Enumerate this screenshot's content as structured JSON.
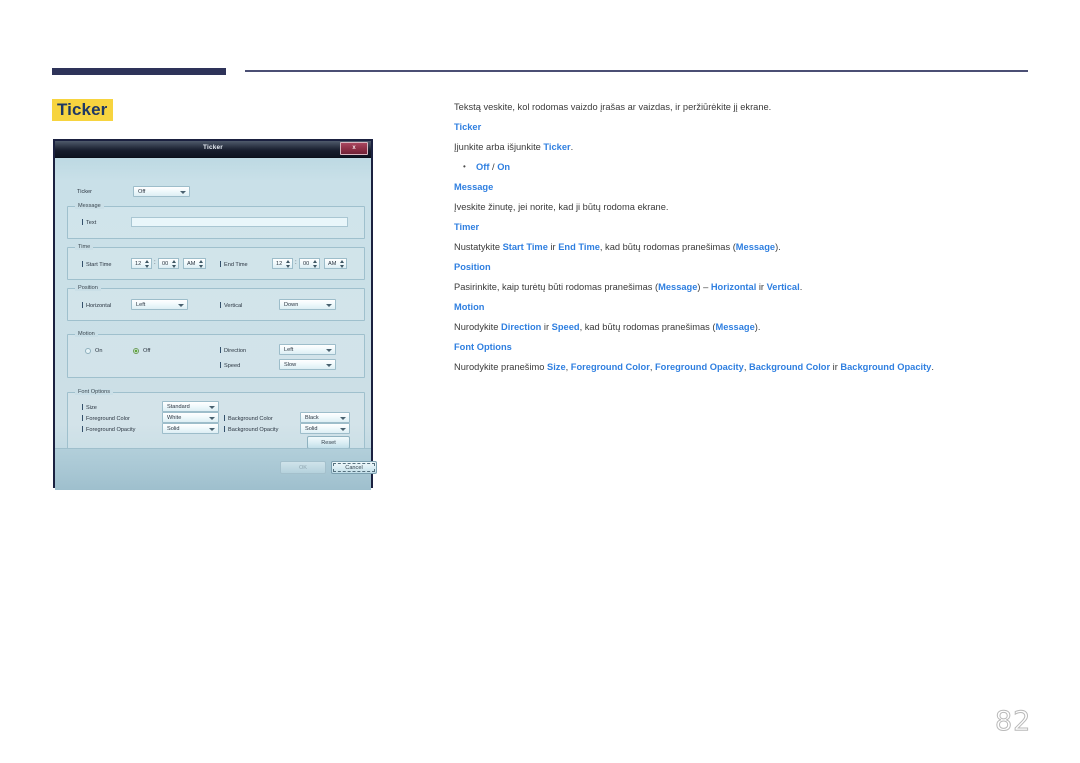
{
  "page": {
    "number": "82",
    "title": "Ticker"
  },
  "dialog": {
    "title": "Ticker",
    "close_label": "x",
    "ticker_row": {
      "label": "Ticker",
      "value": "Off"
    },
    "message_group": {
      "legend": "Message",
      "text_label": "Text",
      "text_value": ""
    },
    "time_group": {
      "legend": "Time",
      "start_label": "Start Time",
      "start_hour": "12",
      "start_minute": "00",
      "start_meridiem": "AM",
      "end_label": "End Time",
      "end_hour": "12",
      "end_minute": "00",
      "end_meridiem": "AM",
      "colon": ":"
    },
    "position_group": {
      "legend": "Position",
      "horizontal_label": "Horizontal",
      "horizontal_value": "Left",
      "vertical_label": "Vertical",
      "vertical_value": "Down"
    },
    "motion_group": {
      "legend": "Motion",
      "on_label": "On",
      "off_label": "Off",
      "selected": "Off",
      "direction_label": "Direction",
      "direction_value": "Left",
      "speed_label": "Speed",
      "speed_value": "Slow"
    },
    "font_options_group": {
      "legend": "Font Options",
      "size_label": "Size",
      "size_value": "Standard",
      "foreground_color_label": "Foreground Color",
      "foreground_color_value": "White",
      "background_color_label": "Background Color",
      "background_color_value": "Black",
      "foreground_opacity_label": "Foreground Opacity",
      "foreground_opacity_value": "Solid",
      "background_opacity_label": "Background Opacity",
      "background_opacity_value": "Solid",
      "reset_label": "Reset"
    },
    "footer": {
      "ok_label": "OK",
      "cancel_label": "Cancel"
    }
  },
  "content": {
    "intro": "Tekstą veskite, kol rodomas vaizdo įrašas ar vaizdas, ir peržiūrėkite jį ekrane.",
    "sections": [
      {
        "heading": "Ticker"
      },
      {
        "body_pre": "Įjunkite arba išjunkite ",
        "body_kw": "Ticker",
        "body_post": "."
      },
      {
        "bullet_a": "Off",
        "bullet_sep": " / ",
        "bullet_b": "On"
      },
      {
        "heading": "Message"
      },
      {
        "body": "Įveskite žinutę, jei norite, kad ji būtų rodoma ekrane."
      },
      {
        "heading": "Timer"
      },
      {
        "t_pre": "Nustatykite ",
        "t_kw1": "Start Time",
        "t_mid1": " ir ",
        "t_kw2": "End Time",
        "t_mid2": ", kad būtų rodomas pranešimas (",
        "t_kw3": "Message",
        "t_post": ")."
      },
      {
        "heading": "Position"
      },
      {
        "p_pre": "Pasirinkite, kaip turėtų būti rodomas pranešimas (",
        "p_kw1": "Message",
        "p_mid1": ") – ",
        "p_kw2": "Horizontal",
        "p_mid2": " ir ",
        "p_kw3": "Vertical",
        "p_post": "."
      },
      {
        "heading": "Motion"
      },
      {
        "m_pre": "Nurodykite ",
        "m_kw1": "Direction",
        "m_mid1": " ir ",
        "m_kw2": "Speed",
        "m_mid2": ", kad būtų rodomas pranešimas (",
        "m_kw3": "Message",
        "m_post": ")."
      },
      {
        "heading": "Font Options"
      },
      {
        "f_pre": "Nurodykite pranešimo ",
        "f_kw1": "Size",
        "f_mid1": ", ",
        "f_kw2": "Foreground Color",
        "f_mid2": ", ",
        "f_kw3": "Foreground Opacity",
        "f_mid3": ", ",
        "f_kw4": "Background Color",
        "f_mid4": " ir ",
        "f_kw5": "Background Opacity",
        "f_post": "."
      }
    ]
  },
  "colors": {
    "accent_blue": "#2f7fe0",
    "highlight_yellow": "#f7d43f",
    "title_navy": "#1f3864",
    "rule_navy": "#2e3359",
    "dialog_bg": "#c8dfe7"
  }
}
